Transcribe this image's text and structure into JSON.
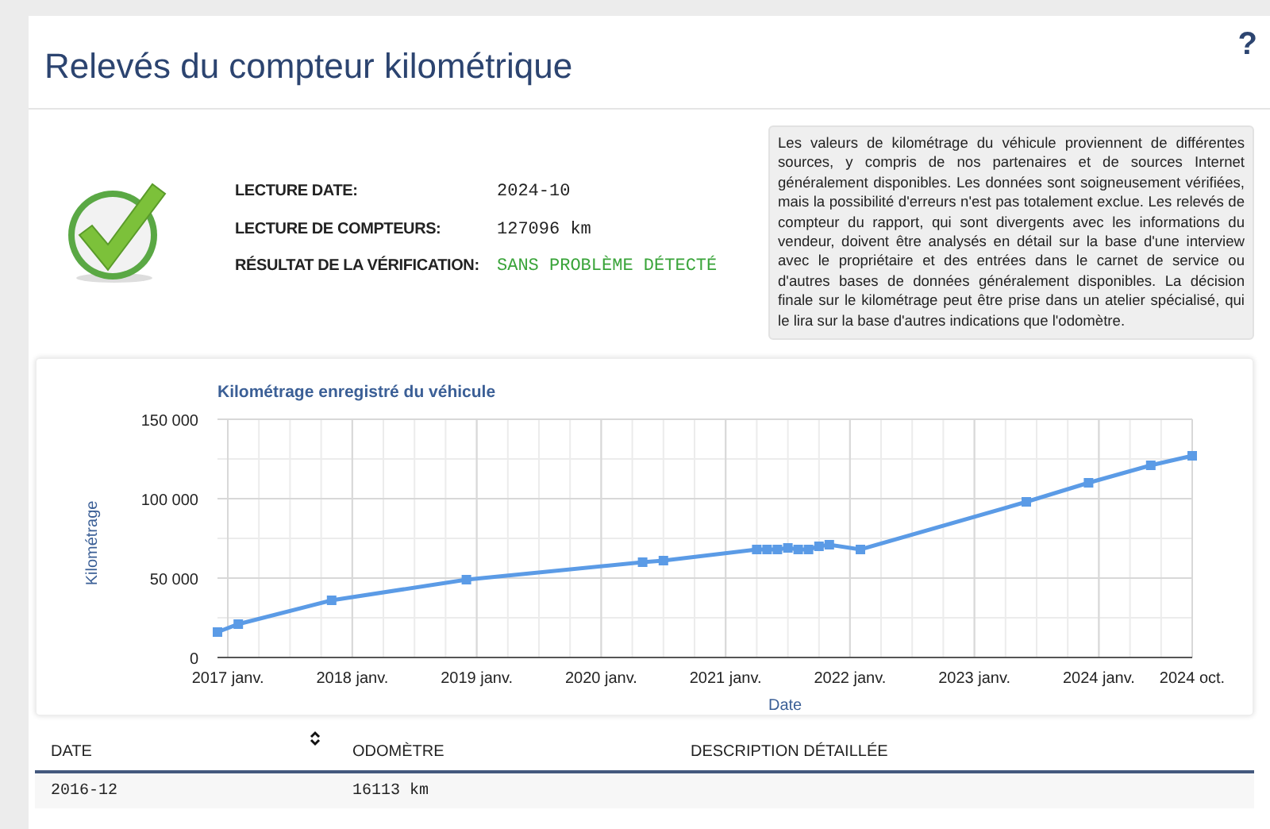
{
  "header": {
    "title": "Relevés du compteur kilométrique",
    "help": "?"
  },
  "summary": {
    "fields": [
      {
        "label": "LECTURE DATE:",
        "value": "2024-10",
        "kind": "plain"
      },
      {
        "label": "LECTURE DE COMPTEURS:",
        "value": "127096 km",
        "kind": "plain"
      },
      {
        "label": "RÉSULTAT DE LA VÉRIFICATION:",
        "value": "SANS PROBLÈME DÉTECTÉ",
        "kind": "ok"
      }
    ],
    "note": "Les valeurs de kilométrage du véhicule proviennent de différentes sources, y compris de nos partenaires et de sources Internet généralement disponibles. Les données sont soigneusement vérifiées, mais la possibilité d'erreurs n'est pas totalement exclue. Les relevés de compteur du rapport, qui sont divergents avec les informations du vendeur, doivent être analysés en détail sur la base d'une interview avec le propriétaire et des entrées dans le carnet de service ou d'autres bases de données généralement disponibles. La décision finale sur le kilométrage peut être prise dans un atelier spécialisé, qui le lira sur la base d'autres indications que l'odomètre."
  },
  "chart": {
    "chart_data": {
      "type": "line",
      "title": "Kilométrage enregistré du véhicule",
      "xlabel": "Date",
      "ylabel": "Kilométrage",
      "x": [
        "2016-12",
        "2017-02",
        "2017-11",
        "2018-12",
        "2020-05",
        "2020-07",
        "2021-04",
        "2021-05",
        "2021-06",
        "2021-07",
        "2021-08",
        "2021-09",
        "2021-10",
        "2021-11",
        "2022-02",
        "2023-06",
        "2023-12",
        "2024-06",
        "2024-10"
      ],
      "series": [
        {
          "color": "#5b9be6",
          "marker": "square",
          "values": [
            16000,
            21000,
            36000,
            49000,
            60000,
            61000,
            68000,
            68000,
            68000,
            69000,
            68000,
            68000,
            70000,
            71000,
            68000,
            98000,
            110000,
            121000,
            127000
          ]
        }
      ],
      "grid": true,
      "xlim": [
        "2016-12",
        "2024-10"
      ],
      "ylim": [
        0,
        150000
      ],
      "xticks": [
        {
          "value": "2017-01",
          "label": "2017 janv."
        },
        {
          "value": "2018-01",
          "label": "2018 janv."
        },
        {
          "value": "2019-01",
          "label": "2019 janv."
        },
        {
          "value": "2020-01",
          "label": "2020 janv."
        },
        {
          "value": "2021-01",
          "label": "2021 janv."
        },
        {
          "value": "2022-01",
          "label": "2022 janv."
        },
        {
          "value": "2023-01",
          "label": "2023 janv."
        },
        {
          "value": "2024-01",
          "label": "2024 janv."
        },
        {
          "value": "2024-10",
          "label": "2024 oct."
        }
      ],
      "yticks": [
        {
          "value": 0,
          "label": "0"
        },
        {
          "value": 50000,
          "label": "50 000"
        },
        {
          "value": 100000,
          "label": "100 000"
        },
        {
          "value": 150000,
          "label": "150 000"
        }
      ]
    }
  },
  "table": {
    "columns": [
      {
        "label": "DATE"
      },
      {
        "label": "ODOMÈTRE"
      },
      {
        "label": "DESCRIPTION DÉTAILLÉE"
      }
    ],
    "rows": [
      {
        "date": "2016-12",
        "odometer": "16113 km"
      }
    ]
  }
}
